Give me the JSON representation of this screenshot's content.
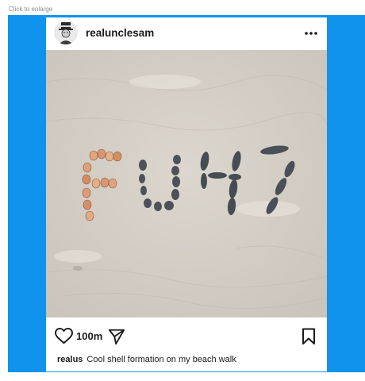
{
  "page": {
    "click_note": "Click to enlarge"
  },
  "post": {
    "username": "realunclesam",
    "photo_text": "FU47",
    "likes": "100m",
    "caption_user": "realus",
    "caption_text": "Cool shell formation on my beach walk"
  },
  "colors": {
    "frame": "#0f93ec",
    "sand": "#d9d4cb",
    "text": "#1a1a1a"
  },
  "icons": {
    "more": "more-icon",
    "like": "heart-icon",
    "share": "send-icon",
    "save": "bookmark-icon",
    "avatar": "uncle-sam-avatar"
  }
}
